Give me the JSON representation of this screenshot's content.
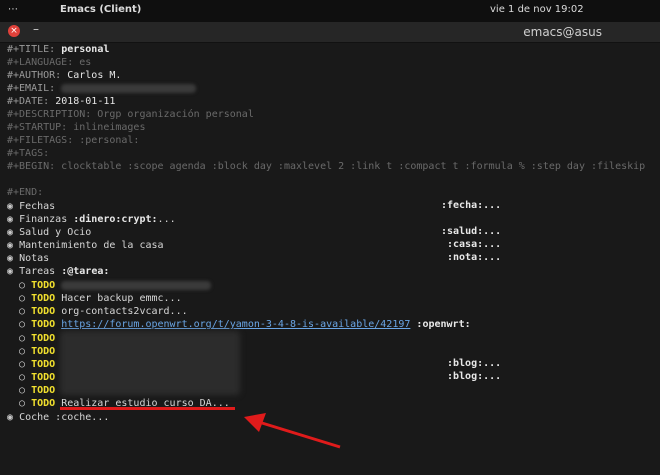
{
  "topbar": {
    "dots": "⋯",
    "app": "Emacs (Client)",
    "clock": "vie 1 de nov  19:02"
  },
  "window": {
    "title": "emacs@asus",
    "minimize": "–",
    "close": "×"
  },
  "header": {
    "title_key": "#+TITLE:",
    "title_val": "personal",
    "language": "#+LANGUAGE: es",
    "author_key": "#+AUTHOR:",
    "author_val": "Carlos M.",
    "email_key": "#+EMAIL:",
    "date_key": "#+DATE:",
    "date_val": "2018-01-11",
    "description": "#+DESCRIPTION: Orgp organización personal",
    "startup": "#+STARTUP: inlineimages",
    "filetags": "#+FILETAGS: :personal:",
    "tags": "#+TAGS:",
    "begin": "#+BEGIN: clocktable :scope agenda :block day :maxlevel 2 :link t :compact t :formula % :step day :fileskip",
    "end": "#+END:"
  },
  "headings": [
    {
      "bullet": "◉",
      "text": "Fechas",
      "tag": ":fecha:..."
    },
    {
      "bullet": "◉",
      "text": "Finanzas ",
      "bold": ":dinero:crypt:",
      "ellipsis": "...",
      "tag": ""
    },
    {
      "bullet": "◉",
      "text": "Salud y Ocio",
      "tag": ":salud:..."
    },
    {
      "bullet": "◉",
      "text": "Mantenimiento de la casa",
      "tag": ":casa:..."
    },
    {
      "bullet": "◉",
      "text": "Notas",
      "tag": ":nota:..."
    },
    {
      "bullet": "◉",
      "text": "Tareas ",
      "bold": ":@tarea:"
    }
  ],
  "todos": [
    {
      "kw": "TODO",
      "text": ""
    },
    {
      "kw": "TODO",
      "text": "Hacer backup emmc..."
    },
    {
      "kw": "TODO",
      "text": "org-contacts2vcard..."
    },
    {
      "kw": "TODO",
      "link": "https://forum.openwrt.org/t/yamon-3-4-8-is-available/42197",
      "tag": ":openwrt:"
    },
    {
      "kw": "TODO",
      "text": ""
    },
    {
      "kw": "TODO",
      "text": ""
    },
    {
      "kw": "TODO",
      "text": "",
      "tag": ":blog:..."
    },
    {
      "kw": "TODO",
      "text": "",
      "tag": ":blog:..."
    },
    {
      "kw": "TODO",
      "text": ""
    },
    {
      "kw": "TODO",
      "text": "Realizar estudio curso DA..."
    }
  ],
  "todo_bullet": "○",
  "last_heading": {
    "bullet": "◉",
    "text": "Coche :coche..."
  }
}
